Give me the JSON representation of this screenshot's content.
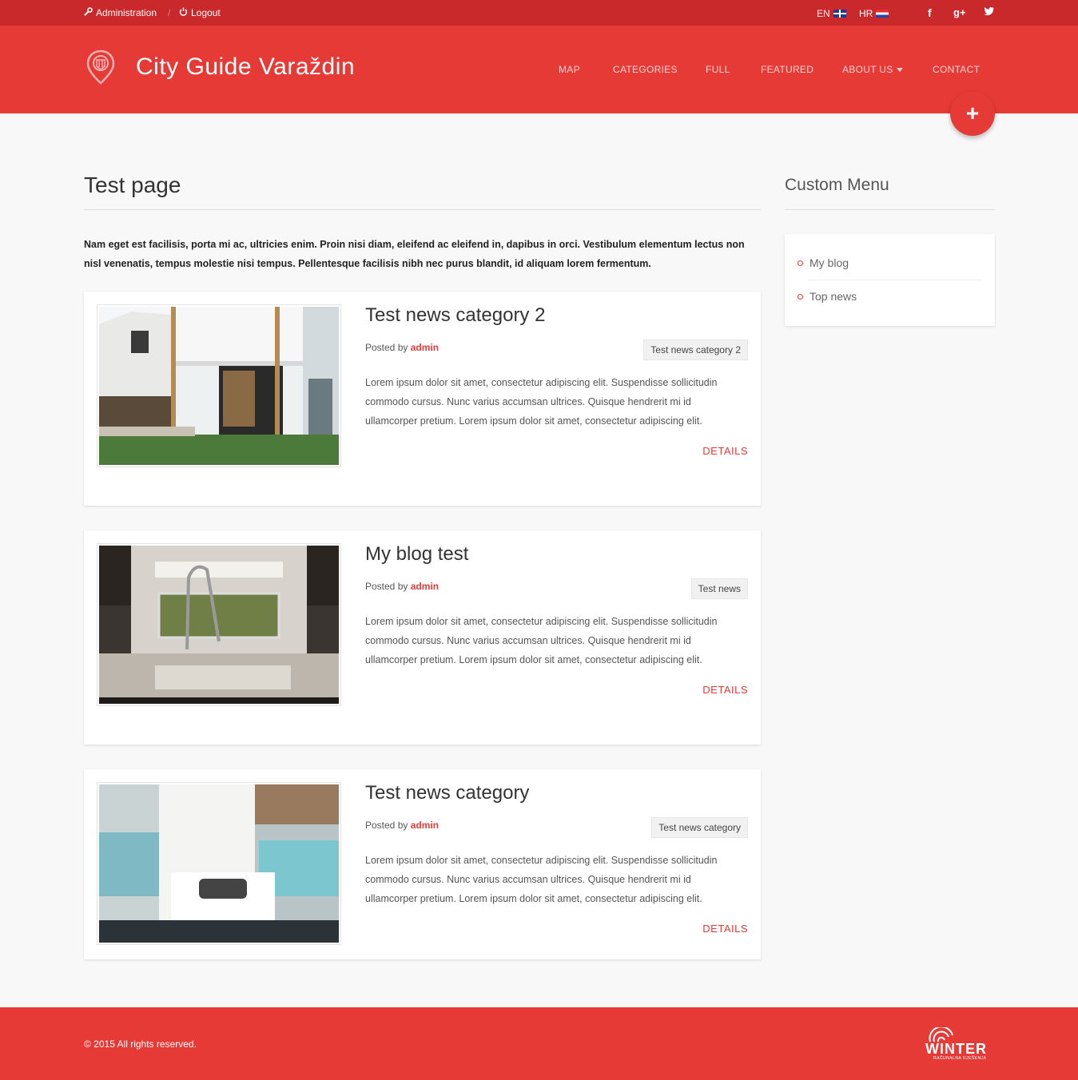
{
  "topbar": {
    "admin_label": "Administration",
    "logout_label": "Logout",
    "lang_en": "EN",
    "lang_hr": "HR"
  },
  "header": {
    "site_title": "City Guide Varaždin",
    "nav": [
      "MAP",
      "CATEGORIES",
      "FULL",
      "FEATURED",
      "ABOUT US",
      "CONTACT"
    ],
    "fab_label": "+"
  },
  "main": {
    "page_title": "Test page",
    "intro": "Nam eget est facilisis, porta mi ac, ultricies enim. Proin nisi diam, eleifend ac eleifend in, dapibus in orci. Vestibulum elementum lectus non nisl venenatis, tempus molestie nisi tempus. Pellentesque facilisis nibh nec purus blandit, id aliquam lorem fermentum.",
    "posts": [
      {
        "title": "Test news category 2",
        "posted_by": "Posted by",
        "author": "admin",
        "category": "Test news category 2",
        "excerpt": "Lorem ipsum dolor sit amet, consectetur adipiscing elit. Suspendisse sollicitudin commodo cursus. Nunc varius accumsan ultrices. Quisque hendrerit mi id ullamcorper pretium. Lorem ipsum dolor sit amet, consectetur adipiscing elit.",
        "details": "DETAILS"
      },
      {
        "title": "My blog test",
        "posted_by": "Posted by",
        "author": "admin",
        "category": "Test news",
        "excerpt": "Lorem ipsum dolor sit amet, consectetur adipiscing elit. Suspendisse sollicitudin commodo cursus. Nunc varius accumsan ultrices. Quisque hendrerit mi id ullamcorper pretium. Lorem ipsum dolor sit amet, consectetur adipiscing elit.",
        "details": "DETAILS"
      },
      {
        "title": "Test news category",
        "posted_by": "Posted by",
        "author": "admin",
        "category": "Test news category",
        "excerpt": "Lorem ipsum dolor sit amet, consectetur adipiscing elit. Suspendisse sollicitudin commodo cursus. Nunc varius accumsan ultrices. Quisque hendrerit mi id ullamcorper pretium. Lorem ipsum dolor sit amet, consectetur adipiscing elit.",
        "details": "DETAILS"
      }
    ]
  },
  "sidebar": {
    "title": "Custom Menu",
    "items": [
      "My blog",
      "Top news"
    ]
  },
  "footer": {
    "copyright": "© 2015 All rights reserved.",
    "brand": "WINTER",
    "brand_sub": "RAČUNALNA RJEŠENJA"
  },
  "colors": {
    "brand_red": "#e53a36",
    "topbar_red": "#c9292b"
  },
  "icons": [
    "wrench-icon",
    "power-icon",
    "uk-flag-icon",
    "hr-flag-icon",
    "facebook-icon",
    "google-plus-icon",
    "twitter-icon",
    "map-pin-logo-icon",
    "plus-icon",
    "caret-down-icon"
  ]
}
